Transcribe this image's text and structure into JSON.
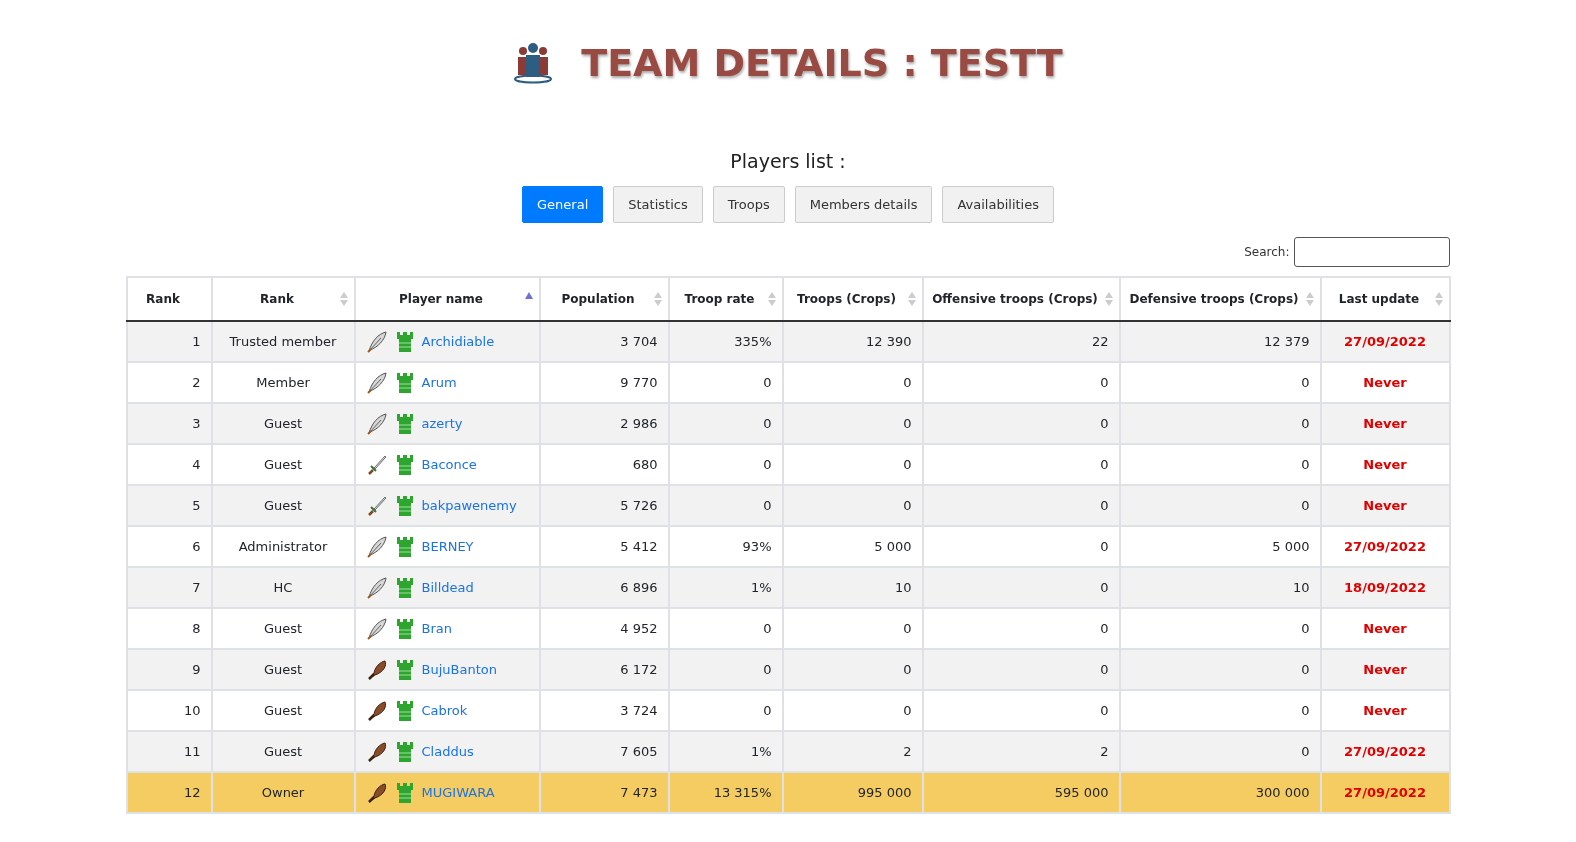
{
  "header": {
    "title": "TEAM DETAILS : TESTT"
  },
  "section_title": "Players list :",
  "tabs": [
    {
      "label": "General",
      "selected": true
    },
    {
      "label": "Statistics",
      "selected": false
    },
    {
      "label": "Troops",
      "selected": false
    },
    {
      "label": "Members details",
      "selected": false
    },
    {
      "label": "Availabilities",
      "selected": false
    }
  ],
  "search": {
    "label": "Search:"
  },
  "table": {
    "columns": [
      {
        "label": "Rank",
        "kind": "plain"
      },
      {
        "label": "Rank",
        "kind": "sortable"
      },
      {
        "label": "Player name",
        "kind": "sorted"
      },
      {
        "label": "Population",
        "kind": "sortable"
      },
      {
        "label": "Troop rate",
        "kind": "sortable"
      },
      {
        "label": "Troops (Crops)",
        "kind": "sortable"
      },
      {
        "label": "Offensive troops (Crops)",
        "kind": "sortable"
      },
      {
        "label": "Defensive troops (Crops)",
        "kind": "sortable"
      },
      {
        "label": "Last update",
        "kind": "sortable"
      }
    ],
    "rows": [
      {
        "rank": "1",
        "role": "Trusted member",
        "kind": "feather",
        "player": "Archidiable",
        "population": "3 704",
        "troop_rate": "335%",
        "troops": "12 390",
        "offensive": "22",
        "defensive": "12 379",
        "last_update": "27/09/2022",
        "highlighted": false
      },
      {
        "rank": "2",
        "role": "Member",
        "kind": "feather",
        "player": "Arum",
        "population": "9 770",
        "troop_rate": "0",
        "troops": "0",
        "offensive": "0",
        "defensive": "0",
        "last_update": "Never",
        "highlighted": false
      },
      {
        "rank": "3",
        "role": "Guest",
        "kind": "feather",
        "player": "azerty",
        "population": "2 986",
        "troop_rate": "0",
        "troops": "0",
        "offensive": "0",
        "defensive": "0",
        "last_update": "Never",
        "highlighted": false
      },
      {
        "rank": "4",
        "role": "Guest",
        "kind": "sword",
        "player": "Baconce",
        "population": "680",
        "troop_rate": "0",
        "troops": "0",
        "offensive": "0",
        "defensive": "0",
        "last_update": "Never",
        "highlighted": false
      },
      {
        "rank": "5",
        "role": "Guest",
        "kind": "sword",
        "player": "bakpawenemy",
        "population": "5 726",
        "troop_rate": "0",
        "troops": "0",
        "offensive": "0",
        "defensive": "0",
        "last_update": "Never",
        "highlighted": false
      },
      {
        "rank": "6",
        "role": "Administrator",
        "kind": "feather",
        "player": "BERNEY",
        "population": "5 412",
        "troop_rate": "93%",
        "troops": "5 000",
        "offensive": "0",
        "defensive": "5 000",
        "last_update": "27/09/2022",
        "highlighted": false
      },
      {
        "rank": "7",
        "role": "HC",
        "kind": "feather",
        "player": "Billdead",
        "population": "6 896",
        "troop_rate": "1%",
        "troops": "10",
        "offensive": "0",
        "defensive": "10",
        "last_update": "18/09/2022",
        "highlighted": false
      },
      {
        "rank": "8",
        "role": "Guest",
        "kind": "feather",
        "player": "Bran",
        "population": "4 952",
        "troop_rate": "0",
        "troops": "0",
        "offensive": "0",
        "defensive": "0",
        "last_update": "Never",
        "highlighted": false
      },
      {
        "rank": "9",
        "role": "Guest",
        "kind": "club",
        "player": "BujuBanton",
        "population": "6 172",
        "troop_rate": "0",
        "troops": "0",
        "offensive": "0",
        "defensive": "0",
        "last_update": "Never",
        "highlighted": false
      },
      {
        "rank": "10",
        "role": "Guest",
        "kind": "club",
        "player": "Cabrok",
        "population": "3 724",
        "troop_rate": "0",
        "troops": "0",
        "offensive": "0",
        "defensive": "0",
        "last_update": "Never",
        "highlighted": false
      },
      {
        "rank": "11",
        "role": "Guest",
        "kind": "club",
        "player": "Claddus",
        "population": "7 605",
        "troop_rate": "1%",
        "troops": "2",
        "offensive": "2",
        "defensive": "0",
        "last_update": "27/09/2022",
        "highlighted": false
      },
      {
        "rank": "12",
        "role": "Owner",
        "kind": "club",
        "player": "MUGIWARA",
        "population": "7 473",
        "troop_rate": "13 315%",
        "troops": "995 000",
        "offensive": "595 000",
        "defensive": "300 000",
        "last_update": "27/09/2022",
        "highlighted": true
      }
    ]
  }
}
